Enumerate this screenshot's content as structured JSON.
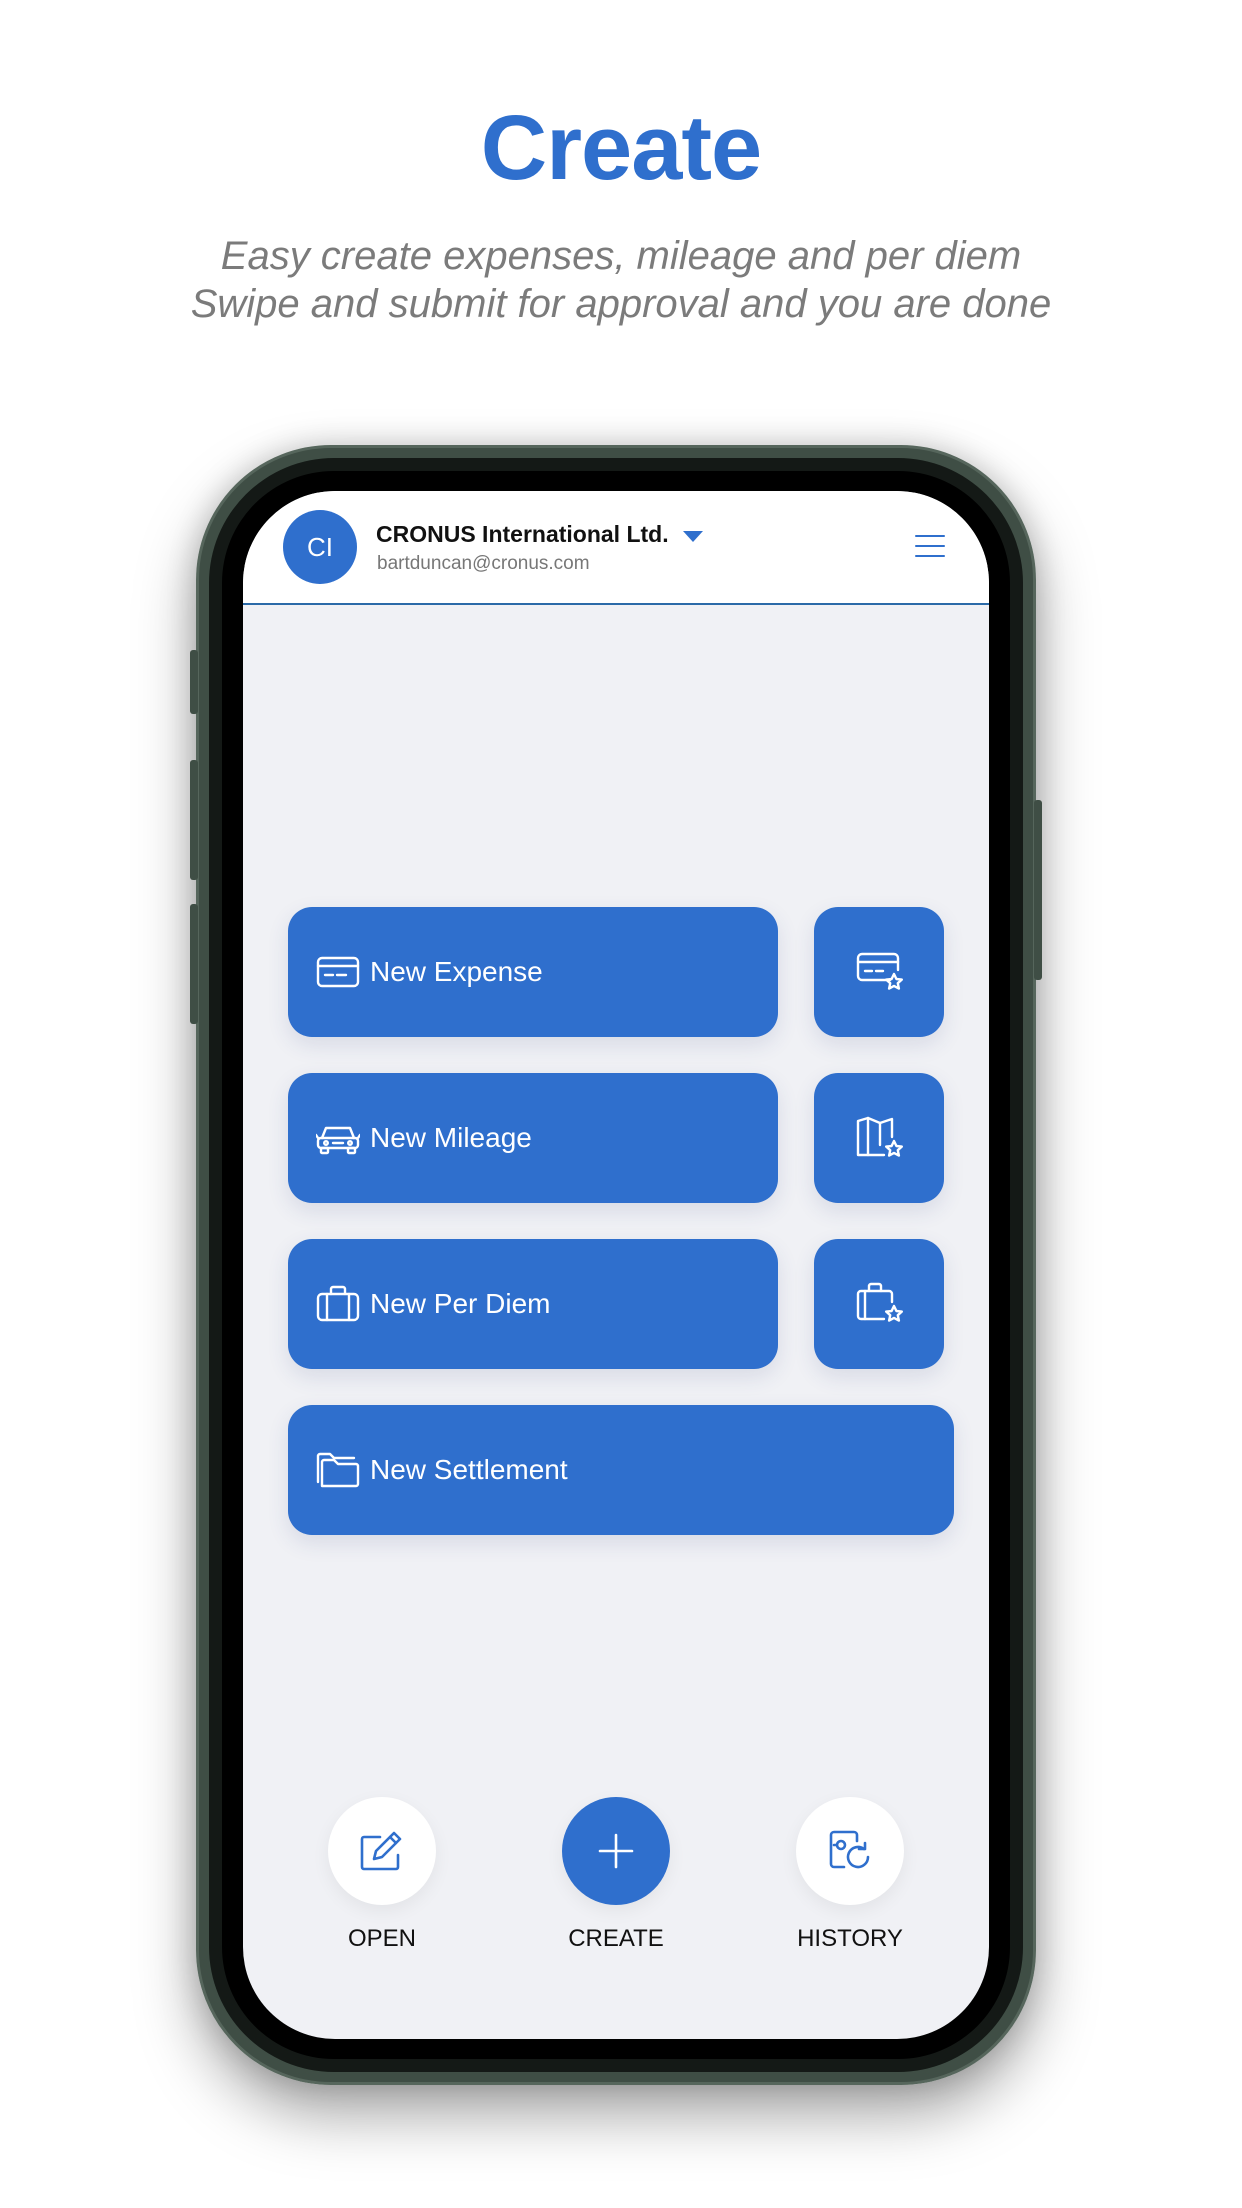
{
  "hero": {
    "title": "Create",
    "subtitle_line1": "Easy create expenses, mileage and per diem",
    "subtitle_line2": "Swipe and submit for approval and you are done"
  },
  "header": {
    "avatar_initials": "CI",
    "company": "CRONUS International Ltd.",
    "email": "bartduncan@cronus.com"
  },
  "actions": {
    "expense": "New Expense",
    "mileage": "New Mileage",
    "per_diem": "New Per Diem",
    "settlement": "New Settlement"
  },
  "nav": {
    "open": "OPEN",
    "create": "CREATE",
    "history": "HISTORY"
  },
  "colors": {
    "accent": "#2f6fcd",
    "screen_bg": "#f0f1f5",
    "phone_frame": "#3f4e45"
  },
  "icons": {
    "expense": "credit-card-icon",
    "expense_fav": "credit-card-star-icon",
    "mileage": "car-icon",
    "mileage_fav": "map-star-icon",
    "per_diem": "briefcase-icon",
    "per_diem_fav": "briefcase-star-icon",
    "settlement": "folder-icon",
    "open": "edit-icon",
    "create": "plus-icon",
    "history": "history-icon",
    "menu": "hamburger-menu-icon"
  }
}
